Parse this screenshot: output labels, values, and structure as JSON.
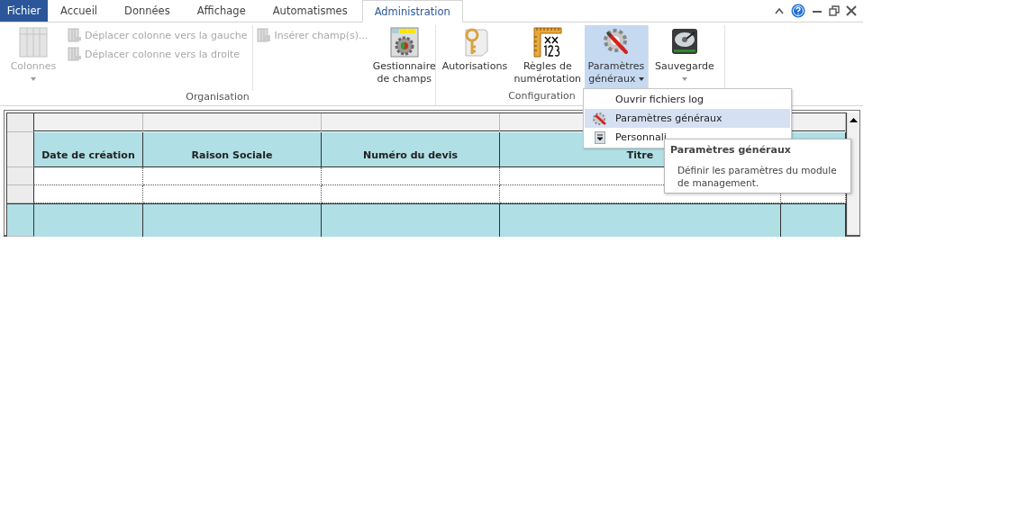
{
  "tabs": [
    {
      "label": "Fichier",
      "kind": "file",
      "selected": false
    },
    {
      "label": "Accueil",
      "kind": "tab",
      "selected": false
    },
    {
      "label": "Données",
      "kind": "tab",
      "selected": false
    },
    {
      "label": "Affichage",
      "kind": "tab",
      "selected": false
    },
    {
      "label": "Automatismes",
      "kind": "tab",
      "selected": false
    },
    {
      "label": "Administration",
      "kind": "tab",
      "selected": true
    }
  ],
  "ribbon": {
    "groups": [
      {
        "label": "Organisation",
        "items": [
          {
            "kind": "large",
            "lines": [
              "Colonnes"
            ],
            "disabled": true,
            "dropdown": true,
            "pressed": false
          },
          {
            "kind": "stack",
            "entries": [
              {
                "label": "Déplacer colonne vers la gauche",
                "disabled": true
              },
              {
                "label": "Déplacer colonne vers la droite",
                "disabled": true
              }
            ]
          },
          {
            "kind": "stack",
            "entries": [
              {
                "label": "Insérer champ(s)...",
                "disabled": true
              }
            ]
          },
          {
            "kind": "large",
            "lines": [
              "Gestionnaire",
              "de champs"
            ],
            "disabled": false,
            "dropdown": false,
            "pressed": false
          }
        ]
      },
      {
        "label": "Configuration",
        "items": [
          {
            "kind": "large",
            "lines": [
              "Autorisations"
            ],
            "disabled": false,
            "dropdown": false,
            "pressed": false
          },
          {
            "kind": "large",
            "lines": [
              "Règles de",
              "numérotation"
            ],
            "disabled": false,
            "dropdown": false,
            "pressed": false
          },
          {
            "kind": "large",
            "lines": [
              "Paramètres",
              "généraux"
            ],
            "disabled": false,
            "dropdown": true,
            "pressed": true
          }
        ]
      },
      {
        "items": [
          {
            "kind": "large",
            "lines": [
              "Sauvegarde"
            ],
            "disabled": false,
            "dropdown": true,
            "pressed": false
          }
        ]
      }
    ]
  },
  "menu": {
    "items": [
      {
        "label": "Ouvrir fichiers log",
        "selected": false
      },
      {
        "label": "Paramètres généraux",
        "selected": true
      },
      {
        "label": "Personnali",
        "selected": false
      }
    ]
  },
  "tooltip": {
    "title": "Paramètres généraux",
    "body": "Définir les paramètres du module de management."
  },
  "grid": {
    "columns": [
      "Date de création",
      "Raison Sociale",
      "Numéro du devis",
      "Titre"
    ]
  }
}
